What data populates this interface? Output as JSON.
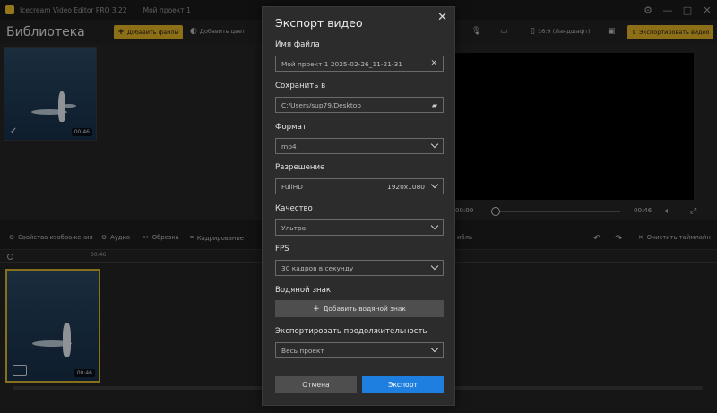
{
  "app": {
    "title": "Icecream Video Editor PRO 3.22",
    "project": "Мой проект 1"
  },
  "window_controls": [
    "⚙",
    "—",
    "□",
    "✕"
  ],
  "toolbar": {
    "library_title": "Библиотека",
    "add_files": "Добавить файлы",
    "add_color": "Добавить цвет",
    "aspect": "16:9 (Ландшафт)",
    "export_video": "Экспортировать видео"
  },
  "library": {
    "items": [
      {
        "duration": "00:46",
        "selected": true
      }
    ]
  },
  "player": {
    "current_time": "00:00",
    "total_time": "00:46"
  },
  "edit_toolbar": {
    "image_props": "Свойства изображения",
    "audio": "Аудио",
    "trim": "Обрезка",
    "crop": "Кадрирование",
    "partial": "ибль",
    "clear_timeline": "Очистить таймлайн"
  },
  "timeline": {
    "ruler_mark": "00:46",
    "clip_duration": "00:46"
  },
  "dialog": {
    "title": "Экспорт видео",
    "filename_label": "Имя файла",
    "filename_value": "Мой проект 1 2025-02-26_11-21-31",
    "save_to_label": "Сохранить в",
    "save_to_value": "C:/Users/sup79/Desktop",
    "format_label": "Формат",
    "format_value": "mp4",
    "resolution_label": "Разрешение",
    "resolution_name": "FullHD",
    "resolution_value": "1920x1080",
    "quality_label": "Качество",
    "quality_value": "Ультра",
    "fps_label": "FPS",
    "fps_value": "30 кадров в секунду",
    "watermark_label": "Водяной знак",
    "add_watermark": "Добавить водяной знак",
    "duration_label": "Экспортировать продолжительность",
    "duration_value": "Весь проект",
    "cancel": "Отмена",
    "export": "Экспорт"
  },
  "colors": {
    "accent": "#e3b326",
    "primary_button": "#1f7fe0",
    "background": "#1e1e1e"
  }
}
